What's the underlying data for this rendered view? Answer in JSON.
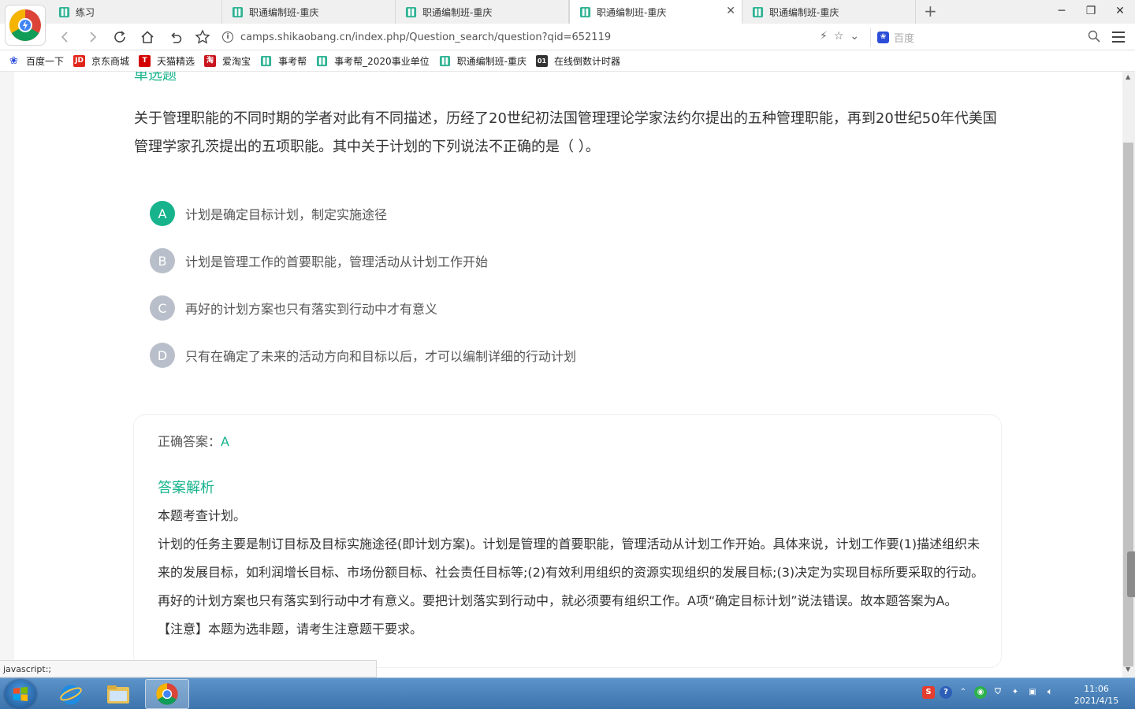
{
  "browser": {
    "tabs": [
      {
        "title": "练习",
        "active": false
      },
      {
        "title": "职通编制班-重庆",
        "active": false
      },
      {
        "title": "职通编制班-重庆",
        "active": false
      },
      {
        "title": "职通编制班-重庆",
        "active": true
      },
      {
        "title": "职通编制班-重庆",
        "active": false
      }
    ],
    "new_tab": "+",
    "url": "camps.shikaobang.cn/index.php/Question_search/question?qid=652119",
    "search_placeholder": "百度",
    "bookmarks": [
      {
        "label": "百度一下",
        "icon": "baidu-paw-icon"
      },
      {
        "label": "京东商城",
        "icon": "jd-icon",
        "badge": "JD"
      },
      {
        "label": "天猫精选",
        "icon": "tmall-icon",
        "badge": "T"
      },
      {
        "label": "爱淘宝",
        "icon": "taobao-icon",
        "badge": "淘"
      },
      {
        "label": "事考帮",
        "icon": "shikaobang-icon"
      },
      {
        "label": "事考帮_2020事业单位",
        "icon": "shikaobang-icon"
      },
      {
        "label": "职通编制班-重庆",
        "icon": "shikaobang-icon"
      },
      {
        "label": "在线倒数计时器",
        "icon": "timer-icon",
        "badge": "01"
      }
    ]
  },
  "question": {
    "type_label": "单选题",
    "stem": "关于管理职能的不同时期的学者对此有不同描述，历经了20世纪初法国管理理论学家法约尔提出的五种管理职能，再到20世纪50年代美国管理学家孔茨提出的五项职能。其中关于计划的下列说法不正确的是（ ）。",
    "options": [
      {
        "letter": "A",
        "text": "计划是确定目标计划，制定实施途径",
        "correct": true
      },
      {
        "letter": "B",
        "text": "计划是管理工作的首要职能，管理活动从计划工作开始",
        "correct": false
      },
      {
        "letter": "C",
        "text": "再好的计划方案也只有落实到行动中才有意义",
        "correct": false
      },
      {
        "letter": "D",
        "text": "只有在确定了未来的活动方向和目标以后，才可以编制详细的行动计划",
        "correct": false
      }
    ]
  },
  "answer": {
    "label": "正确答案：",
    "value": "A",
    "explain_title": "答案解析",
    "explain_lines": [
      "本题考查计划。",
      "计划的任务主要是制订目标及目标实施途径(即计划方案)。计划是管理的首要职能，管理活动从计划工作开始。具体来说，计划工作要(1)描述组织未来的发展目标，如利润增长目标、市场份额目标、社会责任目标等;(2)有效利用组织的资源实现组织的发展目标;(3)决定为实现目标所要采取的行动。再好的计划方案也只有落实到行动中才有意义。要把计划落实到行动中，就必须要有组织工作。A项“确定目标计划”说法错误。故本题答案为A。",
      "【注意】本题为选非题，请考生注意题干要求。"
    ]
  },
  "status_bar": "javascript:;",
  "taskbar": {
    "time": "11:06",
    "date": "2021/4/15"
  },
  "colors": {
    "accent": "#17b38c",
    "option_default": "#b9bfca"
  }
}
